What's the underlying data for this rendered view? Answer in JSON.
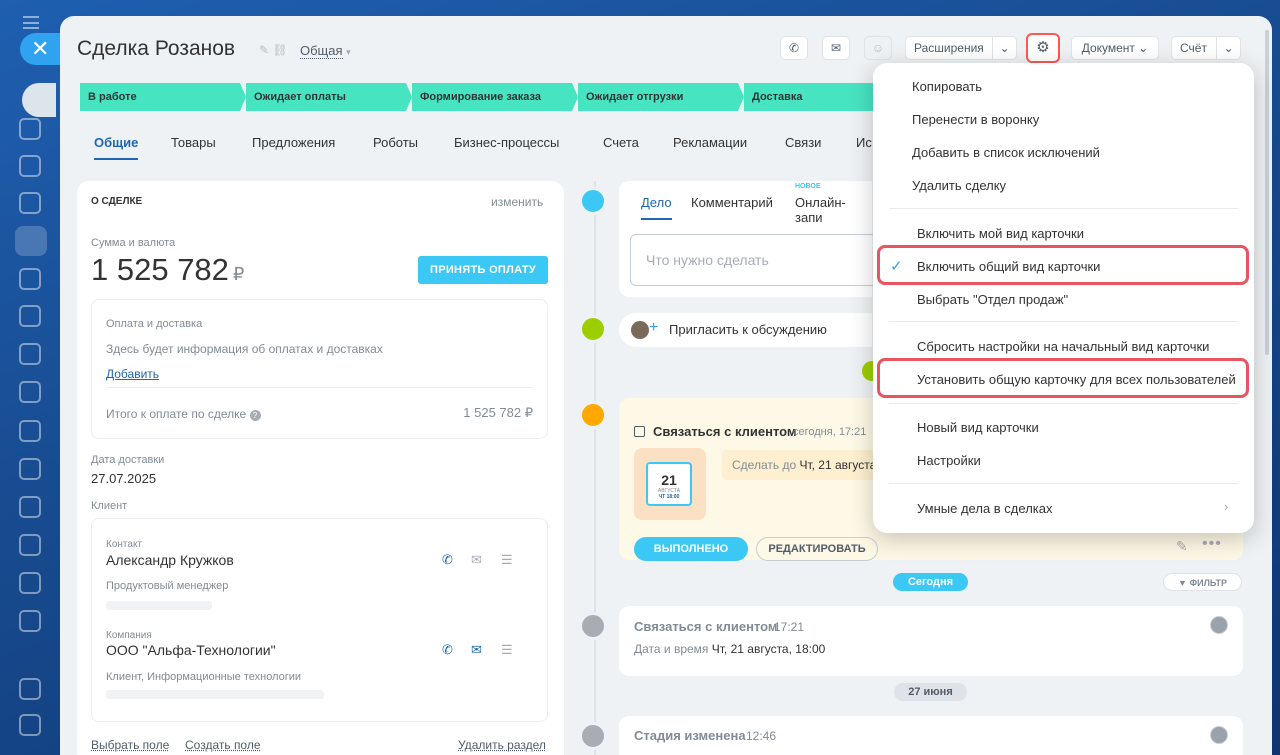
{
  "deal": {
    "title": "Сделка Розанов",
    "category": "Общая"
  },
  "header": {
    "extensions": "Расширения",
    "document": "Документ",
    "invoice": "Счёт"
  },
  "stages": [
    "В работе",
    "Ожидает оплаты",
    "Формирование заказа",
    "Ожидает отгрузки",
    "Доставка"
  ],
  "tabs": [
    "Общие",
    "Товары",
    "Предложения",
    "Роботы",
    "Бизнес-процессы",
    "Счета",
    "Рекламации",
    "Связи",
    "Ис"
  ],
  "left": {
    "section": "О СДЕЛКЕ",
    "edit": "изменить",
    "sum_label": "Сумма и валюта",
    "sum": "1 525 782",
    "currency": "₽",
    "pay_button": "ПРИНЯТЬ ОПЛАТУ",
    "payment_title": "Оплата и доставка",
    "payment_info": "Здесь будет информация об оплатах и доставках",
    "add": "Добавить",
    "total_label": "Итого к оплате по сделке",
    "total": "1 525 782 ₽",
    "delivery_label": "Дата доставки",
    "delivery_date": "27.07.2025",
    "client_label": "Клиент",
    "contact_label": "Контакт",
    "contact_name": "Александр Кружков",
    "contact_role": "Продуктовый менеджер",
    "company_label": "Компания",
    "company_name": "ООО \"Альфа-Технологии\"",
    "company_type": "Клиент, Информационные технологии",
    "select_field": "Выбрать поле",
    "create_field": "Создать поле",
    "delete_section": "Удалить раздел"
  },
  "activity": {
    "tab_deal": "Дело",
    "tab_comment": "Комментарий",
    "tab_online": "Онлайн-запи",
    "new_badge": "НОВОЕ",
    "placeholder": "Что нужно сделать",
    "invite": "Пригласить к обсуждению"
  },
  "task": {
    "title": "Связаться с клиентом",
    "time": "сегодня, 17:21",
    "cal_day": "21",
    "cal_month": "АВГУСТА",
    "cal_time": "ЧТ 18:00",
    "do_by_prefix": "Сделать до",
    "do_by": "Чт, 21 августа",
    "done": "ВЫПОЛНЕНО",
    "edit": "РЕДАКТИРОВАТЬ"
  },
  "timeline": {
    "today": "Сегодня",
    "filter": "ФИЛЬТР",
    "item1_title": "Связаться с клиентом",
    "item1_time": "17:21",
    "item1_label": "Дата и время",
    "item1_value": "Чт, 21 августа, 18:00",
    "date2": "27 июня",
    "item2_title": "Стадия изменена",
    "item2_time": "12:46"
  },
  "menu": {
    "items": [
      "Копировать",
      "Перенести в воронку",
      "Добавить в список исключений",
      "Удалить сделку",
      "Включить мой вид карточки",
      "Включить общий вид карточки",
      "Выбрать \"Отдел продаж\"",
      "Сбросить настройки на начальный вид карточки",
      "Установить общую карточку для всех пользователей",
      "Новый вид карточки",
      "Настройки",
      "Умные дела в сделках"
    ]
  },
  "colors": {
    "stage": "#47e4c2",
    "accent": "#2066b0",
    "highlight": "#e8545f",
    "pay": "#3bc8f5"
  }
}
